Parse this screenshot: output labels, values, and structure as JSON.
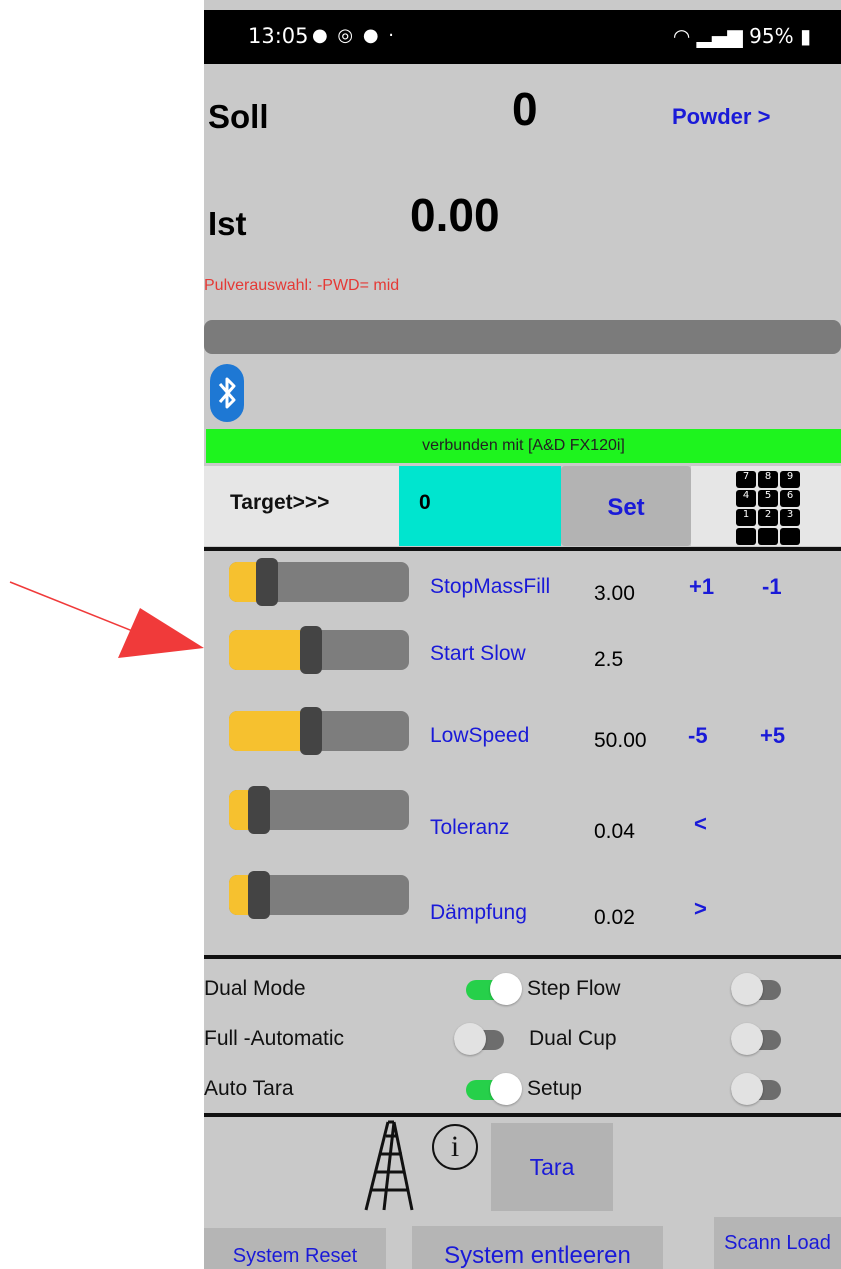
{
  "status_bar": {
    "time": "13:05",
    "battery": "95%"
  },
  "soll": {
    "label": "Soll",
    "value": "0"
  },
  "powder_link": "Powder >",
  "ist": {
    "label": "Ist",
    "value": "0.00"
  },
  "powder_selection": "Pulverauswahl: -PWD= mid",
  "connection_status": "verbunden mit [A&D FX120i]",
  "target": {
    "label": "Target>>>",
    "value": "0",
    "set_label": "Set"
  },
  "keypad_digits": [
    "7",
    "8",
    "9",
    "4",
    "5",
    "6",
    "1",
    "2",
    "3",
    "",
    "",
    ""
  ],
  "sliders": [
    {
      "label": "StopMassFill",
      "value": "3.00",
      "level": 0.17
    },
    {
      "label": "Start Slow",
      "value": "2.5",
      "level": 0.45
    },
    {
      "label": "LowSpeed",
      "value": "50.00",
      "level": 0.45
    },
    {
      "label": "Toleranz",
      "value": "0.04",
      "level": 0.12
    },
    {
      "label": "Dämpfung",
      "value": "0.02",
      "level": 0.12
    }
  ],
  "step_buttons": {
    "plus1": "+1",
    "minus1": "-1",
    "minus5": "-5",
    "plus5": "+5",
    "prev": "<",
    "next": ">"
  },
  "toggles": {
    "dual_mode": {
      "label": "Dual Mode",
      "on": true
    },
    "step_flow": {
      "label": "Step Flow",
      "on": false
    },
    "full_automatic": {
      "label": "Full  -Automatic",
      "on": false
    },
    "dual_cup": {
      "label": "Dual Cup",
      "on": false
    },
    "auto_tara": {
      "label": "Auto Tara",
      "on": true
    },
    "setup": {
      "label": "Setup",
      "on": false
    }
  },
  "tara_label": "Tara",
  "bottom_buttons": {
    "system_reset": "System Reset",
    "system_entleeren": "System entleeren",
    "scann_load": "Scann Load"
  },
  "colors": {
    "accent_blue": "#1a1ad8",
    "slider_fill": "#f6c12f",
    "connected_green": "#1ef41e",
    "target_cyan": "#00e5cf",
    "annotation_red": "#f03a3a",
    "warning_red": "#e53935"
  }
}
